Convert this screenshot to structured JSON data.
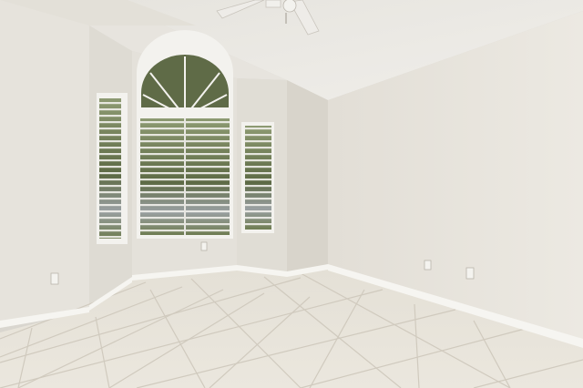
{
  "scene": {
    "subject": "empty room",
    "colors": {
      "wall_lit": "#e9e6df",
      "wall_shadow": "#d6d2c9",
      "ceiling": "#ebe9e4",
      "floor_tile": "#e7e3da",
      "grout": "#cfc9bd",
      "baseboard": "#f6f5f1",
      "window_frame": "#f3f2ee",
      "glass_tree": "#5f6b47",
      "blind_slat": "#f1f0ec"
    },
    "fixtures": {
      "ceiling_fan": "ceiling-fan-icon",
      "outlets": "outlet-icon"
    }
  }
}
